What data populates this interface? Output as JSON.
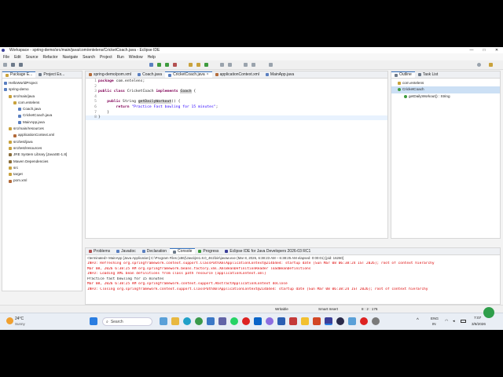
{
  "window": {
    "title": "Workspace - spring-demo/src/main/java/com/entelens/CricketCoach.java - Eclipse IDE",
    "controls": [
      "—",
      "□",
      "✕"
    ]
  },
  "menu": [
    "File",
    "Edit",
    "Source",
    "Refactor",
    "Navigate",
    "Search",
    "Project",
    "Run",
    "Window",
    "Help"
  ],
  "explorer": {
    "tabs": [
      "Package E...",
      "Project Ex..."
    ],
    "items": [
      {
        "label": "HelloWorldProject",
        "depth": 0
      },
      {
        "label": "spring-demo",
        "depth": 0
      },
      {
        "label": "src/main/java",
        "depth": 1
      },
      {
        "label": "com.entelens",
        "depth": 2
      },
      {
        "label": "Coach.java",
        "depth": 3
      },
      {
        "label": "CricketCoach.java",
        "depth": 3
      },
      {
        "label": "MainApp.java",
        "depth": 3
      },
      {
        "label": "src/main/resources",
        "depth": 1
      },
      {
        "label": "applicationContext.xml",
        "depth": 2
      },
      {
        "label": "src/test/java",
        "depth": 1
      },
      {
        "label": "src/test/resources",
        "depth": 1
      },
      {
        "label": "JRE System Library [JavaSE-1.8]",
        "depth": 1
      },
      {
        "label": "Maven Dependencies",
        "depth": 1
      },
      {
        "label": "src",
        "depth": 1
      },
      {
        "label": "target",
        "depth": 1
      },
      {
        "label": "pom.xml",
        "depth": 1
      }
    ]
  },
  "editor": {
    "tabs": [
      "spring-demo/pom.xml",
      "Coach.java",
      "CricketCoach.java",
      "applicationContext.xml",
      "MainApp.java"
    ],
    "active_tab": "CricketCoach.java",
    "line_numbers": [
      "1",
      "2",
      "3",
      "4",
      "5",
      "6",
      "7",
      "8"
    ],
    "lines": {
      "l1_kw": "package",
      "l1_rest": " com.entelens;",
      "l3_kw1": "public class",
      "l3_mid": " CricketCoach ",
      "l3_kw2": "implements",
      "l3_sp": " ",
      "l3_hl": "Coach",
      "l3_end": " {",
      "l5_kw": "public",
      "l5_mid": " String ",
      "l5_hl": "getDailyWorkout",
      "l5_end": "() {",
      "l6_kw": "return",
      "l6_sp": " ",
      "l6_str": "\"Practice Fast bowling for 15 minutes\"",
      "l6_end": ";",
      "l7": "    }",
      "l8": "}"
    }
  },
  "outline": {
    "tabs": [
      "Outline",
      "Task List"
    ],
    "items": [
      "com.entelens",
      "CricketCoach",
      "getDailyWorkout() : String"
    ]
  },
  "console": {
    "tabs": [
      "Problems",
      "Javadoc",
      "Declaration",
      "Console",
      "Progress",
      "Eclipse IDE for Java Developers 2026-03 RC1"
    ],
    "header": "<terminated> MainApp [Java Application] C:\\Program Files (x86)\\Java\\jre1.8.0_461\\bin\\javaw.exe (Mar 8, 2026, 6:38:23 AM – 6:38:25 AM elapsed: 0:00:01) [pid: 16260]",
    "lines": [
      {
        "text": "INFO: Refreshing org.springframework.context.support.ClassPathXmlApplicationContext@214b4e4: startup date [Sun Mar 08 06:38:24 IST 2026]; root of context hierarchy",
        "red": true
      },
      {
        "text": "Mar 08, 2026 6:38:25 AM org.springframework.beans.factory.xml.XmlBeanDefinitionReader loadBeanDefinitions",
        "red": true
      },
      {
        "text": "INFO: Loading XML bean definitions from class path resource [applicationContext.xml]",
        "red": true
      },
      {
        "text": "Practice fast bowling for 15 minutes",
        "red": false
      },
      {
        "text": "Mar 08, 2026 6:38:25 AM org.springframework.context.support.AbstractApplicationContext doClose",
        "red": true
      },
      {
        "text": "INFO: Closing org.springframework.context.support.ClassPathXmlApplicationContext@214b4e4: startup date [Sun Mar 08 06:38:24 IST 2026]; root of context hierarchy",
        "red": true
      }
    ]
  },
  "status": {
    "mode": "Writable",
    "insert": "Smart Insert",
    "position": "8 : 2 : 176"
  },
  "taskbar": {
    "weather_temp": "24°C",
    "weather_desc": "Sunny",
    "search_placeholder": "Search",
    "lang": "ENG",
    "region": "IN",
    "time": "7:07",
    "date": "3/8/2026"
  },
  "colors": {
    "accent": "#3b78c6",
    "keyword": "#7f0055",
    "string": "#2a00ff",
    "error_text": "#dd0000"
  }
}
